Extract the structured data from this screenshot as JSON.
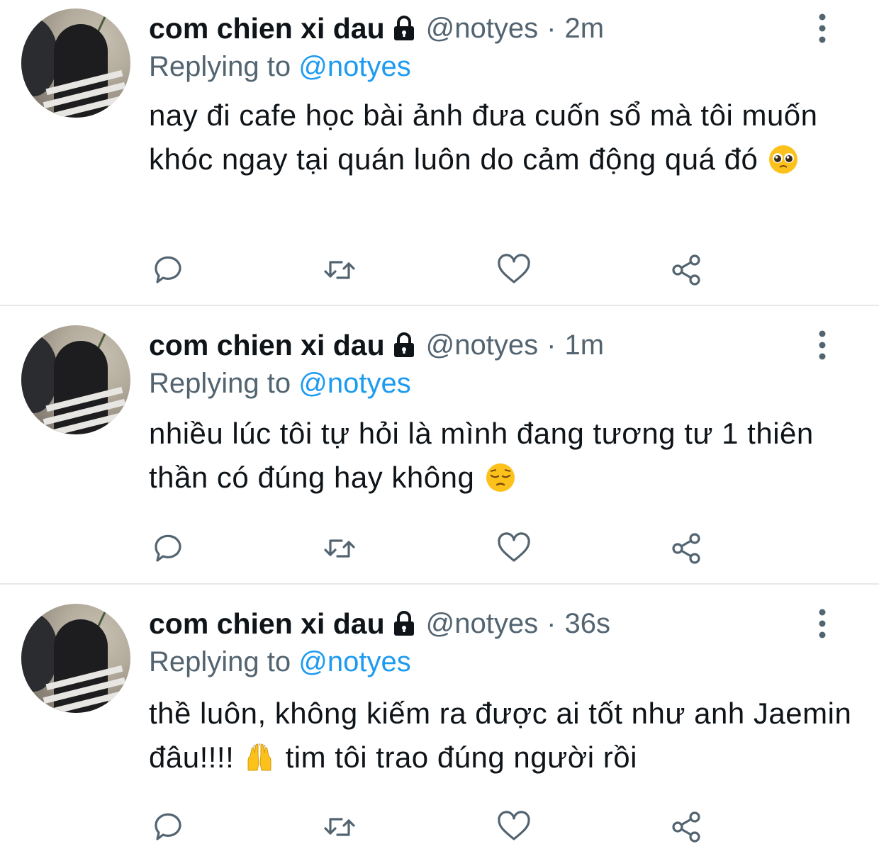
{
  "tweets": [
    {
      "author_name": "com chien xi dau",
      "handle": "@notyes",
      "separator": "·",
      "time": "2m",
      "replying_prefix": "Replying to",
      "replying_handle": "@notyes",
      "text": "nay đi cafe học bài ảnh đưa cuốn sổ mà tôi muốn khóc ngay tại quán luôn do cảm động quá đó",
      "emoji": "pleading-face",
      "icons": [
        "reply-icon",
        "retweet-icon",
        "like-icon",
        "share-icon"
      ]
    },
    {
      "author_name": "com chien xi dau",
      "handle": "@notyes",
      "separator": "·",
      "time": "1m",
      "replying_prefix": "Replying to",
      "replying_handle": "@notyes",
      "text": "nhiều lúc tôi tự hỏi là mình đang tương tư 1 thiên thần có đúng hay không",
      "emoji": "pensive-face",
      "icons": [
        "reply-icon",
        "retweet-icon",
        "like-icon",
        "share-icon"
      ]
    },
    {
      "author_name": "com chien xi dau",
      "handle": "@notyes",
      "separator": "·",
      "time": "36s",
      "replying_prefix": "Replying to",
      "replying_handle": "@notyes",
      "text_before": "thề luôn, không kiếm ra được ai tốt như anh Jaemin đâu!!!!",
      "text_after": "tim tôi trao đúng người rồi",
      "emoji": "raising-hands",
      "icons": [
        "reply-icon",
        "retweet-icon",
        "like-icon",
        "share-icon"
      ]
    }
  ],
  "colors": {
    "text": "#0f1419",
    "secondary": "#536471",
    "accent": "#1d9bf0",
    "divider": "#e6e9ec"
  }
}
